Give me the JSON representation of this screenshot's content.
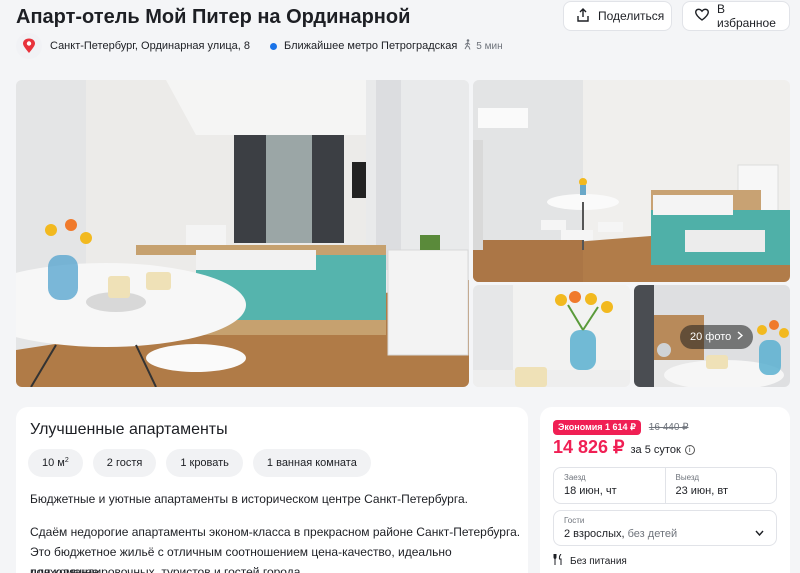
{
  "header": {
    "title": "Апарт-отель Мой Питер на Ординарной",
    "share_label": "Поделиться",
    "favorite_label": "В избранное",
    "address": "Санкт-Петербург, Ординарная улица, 8",
    "metro": "Ближайшее метро Петроградская",
    "walk_time": "5 мин"
  },
  "gallery": {
    "more_photos_label": "20 фото"
  },
  "room": {
    "title": "Улучшенные апартаменты",
    "area": "10 м",
    "area_sup": "2",
    "guests": "2 гостя",
    "beds": "1 кровать",
    "bathroom": "1 ванная комната",
    "desc_1": "Бюджетные и уютные апартаменты в историческом центре Санкт-Петербурга.",
    "desc_2": "Сдаём недорогие апартаменты эконом-класса в прекрасном районе Санкт-Петербурга.",
    "desc_3": "Это бюджетное жильё с отличным соотношением цена-качество, идеально подходящее",
    "desc_4": "для командировочных, туристов и гостей города."
  },
  "booking": {
    "economy_label": "Экономия 1 614 ₽",
    "old_price": "16 440 ₽",
    "price": "14 826 ₽",
    "nights": "за 5 суток",
    "checkin_label": "Заезд",
    "checkin_value": "18 июн, чт",
    "checkout_label": "Выезд",
    "checkout_value": "23 июн, вт",
    "guests_label": "Гости",
    "guests_value": "2 взрослых,",
    "guests_extra": " без детей",
    "meal": "Без питания"
  },
  "colors": {
    "accent": "#f01f54",
    "metro": "#1a73e8"
  }
}
